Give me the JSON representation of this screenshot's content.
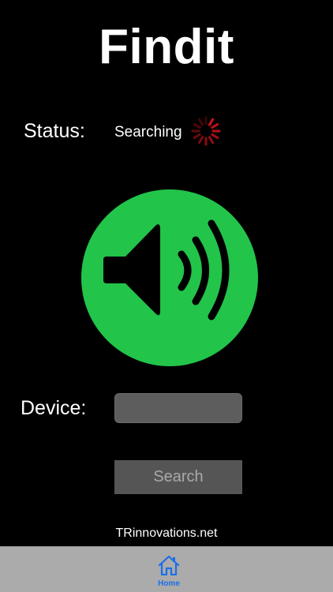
{
  "app": {
    "title": "Findit"
  },
  "status": {
    "label": "Status:",
    "value": "Searching",
    "spinner_color": "#d0141c"
  },
  "speaker": {
    "icon": "speaker-volume-icon",
    "button_color": "#22c44a"
  },
  "device": {
    "label": "Device:",
    "value": "",
    "placeholder": ""
  },
  "search_button": {
    "label": "Search"
  },
  "footer": {
    "link_text": "TRinnovations.net"
  },
  "tab_bar": {
    "tabs": [
      {
        "label": "Home",
        "icon": "home-icon",
        "selected": true,
        "color": "#1a6ee8"
      }
    ]
  }
}
